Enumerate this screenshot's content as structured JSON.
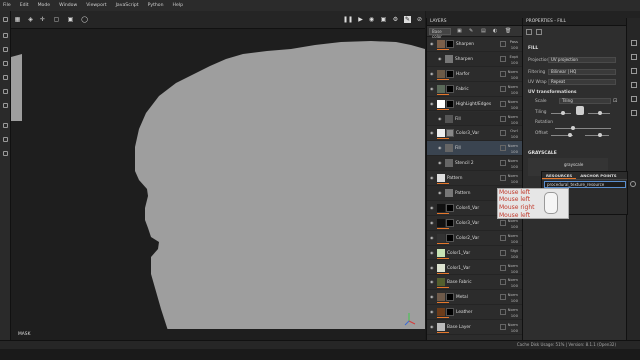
{
  "menu": [
    "File",
    "Edit",
    "Mode",
    "Window",
    "Viewport",
    "JavaScript",
    "Python",
    "Help"
  ],
  "viewport": {
    "camera_select": "Fluid",
    "bottom_label": "MASK",
    "toolbar_icons": [
      "grid-icon",
      "view-icon",
      "axis-icon",
      "frame-icon",
      "camera-icon",
      "pause-icon",
      "play-icon",
      "record-icon",
      "screenshot-icon",
      "settings-icon",
      "brush-icon",
      "pencil-icon"
    ]
  },
  "layers": {
    "title": "LAYERS",
    "channel_select": "Base color",
    "rows": [
      {
        "name": "Sharpen",
        "blend": "Pass",
        "opacity": "100",
        "thumb": "#7a5f4a",
        "mask": "#000",
        "level": 0
      },
      {
        "name": "Sharpen",
        "blend": "Expt",
        "opacity": "100",
        "thumb": "#777",
        "mask": "",
        "level": 1,
        "fx": true
      },
      {
        "name": "Harfor",
        "blend": "Norm",
        "opacity": "100",
        "thumb": "#6b5a47",
        "mask": "#000",
        "level": 0
      },
      {
        "name": "Fabric",
        "blend": "Norm",
        "opacity": "100",
        "thumb": "#5b6a5a",
        "mask": "#000",
        "level": 0
      },
      {
        "name": "HighLight/Edges",
        "blend": "Norm",
        "opacity": "100",
        "thumb": "#ffffff",
        "mask": "#000",
        "level": 0
      },
      {
        "name": "Fill",
        "blend": "Norm",
        "opacity": "100",
        "thumb": "#555",
        "mask": "",
        "level": 1,
        "fx": true
      },
      {
        "name": "Color3_Var",
        "blend": "Ovrl",
        "opacity": "100",
        "thumb": "#eeeeee",
        "mask": "#888",
        "level": 0
      },
      {
        "name": "Fill",
        "blend": "Norm",
        "opacity": "100",
        "thumb": "#666",
        "mask": "",
        "level": 1,
        "fx": true,
        "selected": true
      },
      {
        "name": "Stencil 2",
        "blend": "Norm",
        "opacity": "100",
        "thumb": "#666",
        "mask": "",
        "level": 1,
        "fx": true
      },
      {
        "name": "Pattern",
        "blend": "Norm",
        "opacity": "100",
        "thumb": "#dddddd",
        "mask": "",
        "level": 0
      },
      {
        "name": "Pattern",
        "blend": "",
        "opacity": "",
        "thumb": "#777",
        "mask": "",
        "level": 1,
        "fx": true
      },
      {
        "name": "Color4_Var",
        "blend": "Norm",
        "opacity": "100",
        "thumb": "#111",
        "mask": "#000",
        "level": 0
      },
      {
        "name": "Color3_Var",
        "blend": "Norm",
        "opacity": "100",
        "thumb": "#111",
        "mask": "#000",
        "level": 0
      },
      {
        "name": "Color2_Var",
        "blend": "Norm",
        "opacity": "100",
        "thumb": "#333",
        "mask": "#000",
        "level": 0
      },
      {
        "name": "Color1_Var",
        "blend": "Sfgt",
        "opacity": "100",
        "thumb": "#c7e3b5",
        "mask": "",
        "level": 0
      },
      {
        "name": "Color1_Var",
        "blend": "Norm",
        "opacity": "100",
        "thumb": "#dde3d0",
        "mask": "",
        "level": 0
      },
      {
        "name": "Base Fabric",
        "blend": "Norm",
        "opacity": "100",
        "thumb": "#54602f",
        "mask": "",
        "level": 0
      },
      {
        "name": "Metal",
        "blend": "Norm",
        "opacity": "100",
        "thumb": "#6e5a4a",
        "mask": "#000",
        "level": 0
      },
      {
        "name": "Leather",
        "blend": "Norm",
        "opacity": "100",
        "thumb": "#6c3c1a",
        "mask": "#000",
        "level": 0
      },
      {
        "name": "Base Layer",
        "blend": "Norm",
        "opacity": "100",
        "thumb": "#bbbbbb",
        "mask": "",
        "level": 0
      }
    ]
  },
  "properties": {
    "title": "PROPERTIES - FILL",
    "fill_section": "FILL",
    "projection_label": "Projection",
    "projection_value": "UV projection",
    "filtering_label": "Filtering",
    "filtering_value": "Bilinear | HQ",
    "uvwrap_label": "UV Wrap",
    "uvwrap_value": "Repeat",
    "uv_section": "UV transformations",
    "scale_label": "Scale",
    "scale_value": "Tiling",
    "tiling_label": "Tiling",
    "rotation_label": "Rotation",
    "offset_label": "Offset",
    "grayscale_section": "GRAYSCALE",
    "grayscale_value": "grayscale"
  },
  "resources_popup": {
    "tabs": [
      "RESOURCES",
      "ANCHOR POINTS"
    ],
    "field_value": "procedural_texture_resource"
  },
  "tooltip": {
    "lines": [
      "Mouse left",
      "Mouse left",
      "Mouse right",
      "Mouse left"
    ]
  },
  "status": {
    "text": "Cache Disk Usage:  51% | Version: 8.1.1 (Open32)"
  },
  "colors": {
    "accent": "#e5772b",
    "model_gray": "#9e9e9e",
    "viewport_bg": "#1e1e1e"
  }
}
